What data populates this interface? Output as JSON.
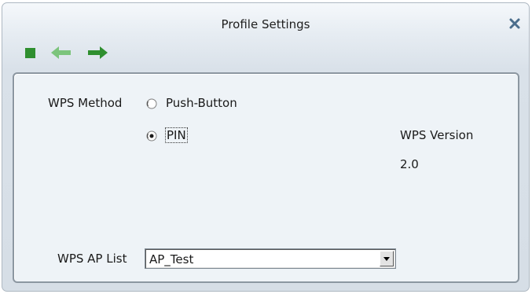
{
  "window": {
    "title": "Profile Settings"
  },
  "toolbar": {
    "icons": [
      "stop-icon",
      "back-arrow-icon",
      "forward-arrow-icon",
      "close-icon"
    ],
    "colors": {
      "stop": "#2f8f2f",
      "back_arrow": "#7cc47c",
      "forward_arrow": "#2f8f2f",
      "close": "#4a6d8c"
    }
  },
  "wps": {
    "method_label": "WPS Method",
    "options": [
      {
        "label": "Push-Button",
        "selected": false
      },
      {
        "label": "PIN",
        "selected": true
      }
    ],
    "version_label": "WPS Version",
    "version_value": "2.0",
    "ap_list_label": "WPS AP List",
    "ap_list_selected": "AP_Test"
  }
}
